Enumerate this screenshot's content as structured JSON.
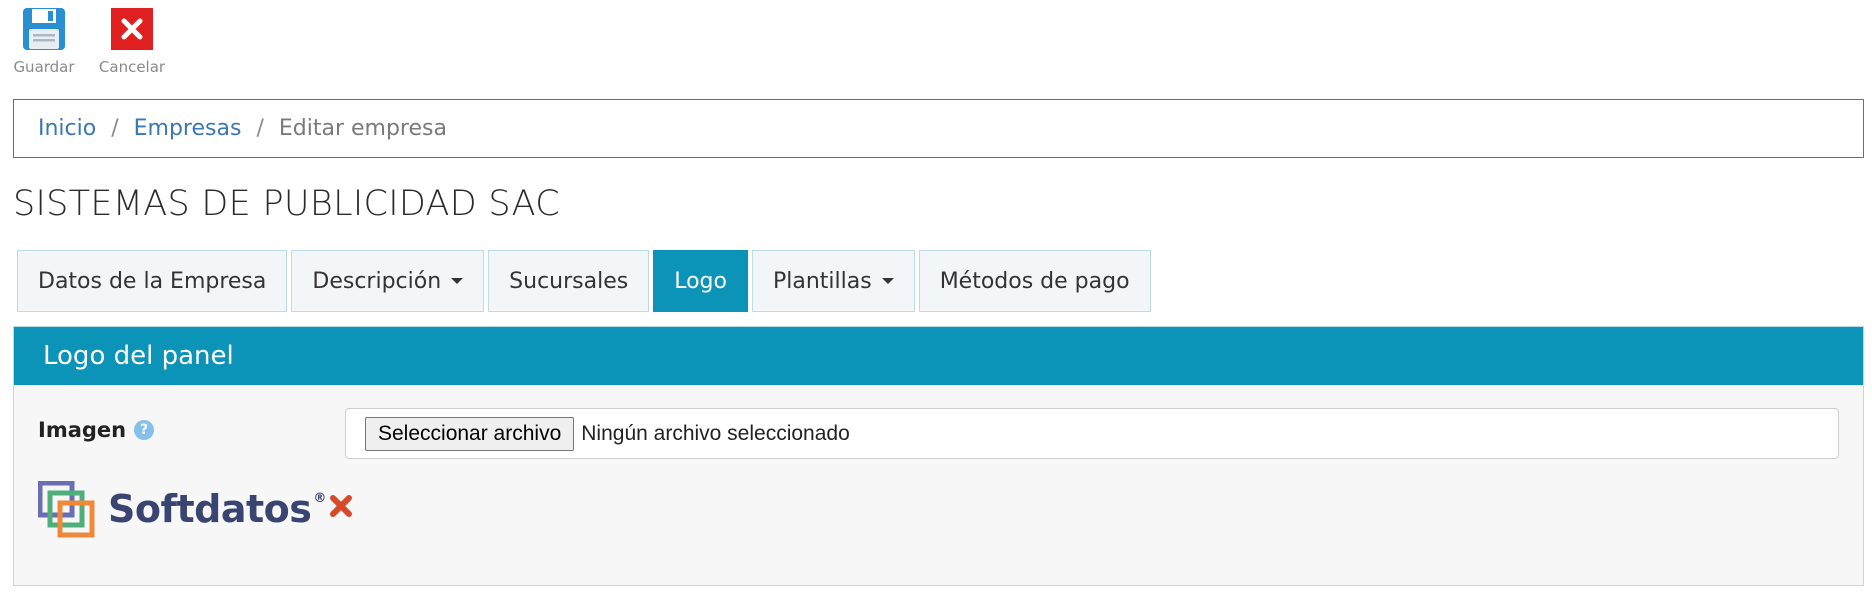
{
  "toolbar": {
    "save_label": "Guardar",
    "cancel_label": "Cancelar"
  },
  "breadcrumb": {
    "items": [
      "Inicio",
      "Empresas",
      "Editar empresa"
    ],
    "separator": "/"
  },
  "company": {
    "title": "SISTEMAS DE PUBLICIDAD SAC"
  },
  "tabs": [
    {
      "label": "Datos de la Empresa",
      "dropdown": false
    },
    {
      "label": "Descripción",
      "dropdown": true
    },
    {
      "label": "Sucursales",
      "dropdown": false
    },
    {
      "label": "Logo",
      "dropdown": false,
      "active": true
    },
    {
      "label": "Plantillas",
      "dropdown": true
    },
    {
      "label": "Métodos de pago",
      "dropdown": false
    }
  ],
  "panel": {
    "title": "Logo del panel",
    "field_label": "Imagen",
    "help_glyph": "?",
    "file_button_label": "Seleccionar archivo",
    "file_status": "Ningún archivo seleccionado",
    "logo_text": "Softdatos",
    "logo_reg": "®"
  },
  "colors": {
    "accent": "#0b93b8",
    "link": "#3a78b5",
    "save_icon": "#2a8fd0",
    "cancel_icon": "#e02020"
  },
  "icons": {
    "save": "floppy-disk-icon",
    "cancel": "close-x-icon",
    "help": "question-circle-icon",
    "remove": "remove-x-icon"
  }
}
